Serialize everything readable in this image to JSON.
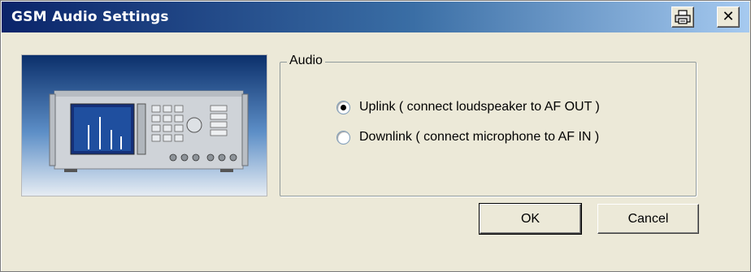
{
  "window": {
    "title": "GSM Audio Settings",
    "title_bar_colors": [
      "#0a246a",
      "#3a6ea5",
      "#a6caf0"
    ],
    "controls": [
      {
        "name": "print",
        "icon": "printer-icon"
      },
      {
        "name": "close",
        "icon": "close-icon",
        "glyph": "✕"
      }
    ]
  },
  "image": {
    "subject": "instrument-photo"
  },
  "audio_group": {
    "label": "Audio",
    "options": [
      {
        "label": "Uplink ( connect loudspeaker to AF OUT )",
        "selected": true
      },
      {
        "label": "Downlink ( connect microphone to AF IN )",
        "selected": false
      }
    ]
  },
  "buttons": {
    "ok": "OK",
    "cancel": "Cancel"
  }
}
